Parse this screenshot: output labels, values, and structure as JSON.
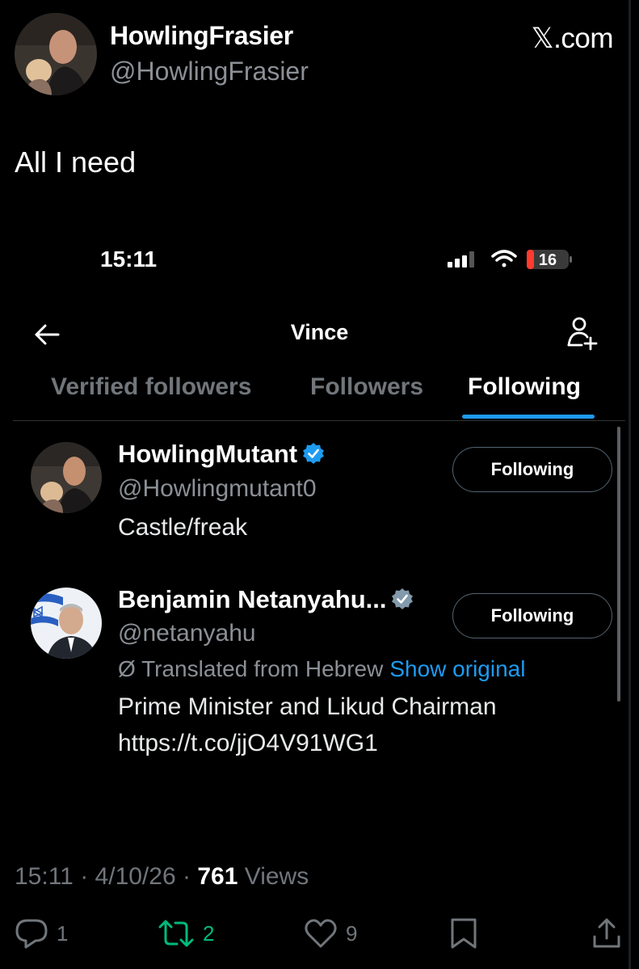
{
  "tweet": {
    "author_name": "HowlingFrasier",
    "author_handle": "@HowlingFrasier",
    "site": "𝕏.com",
    "text": "All I need",
    "time": "15:11",
    "date": "4/10/26",
    "separator": "·",
    "views_count": "761",
    "views_label": "Views",
    "replies": "1",
    "retweets": "2",
    "likes": "9"
  },
  "screenshot": {
    "status_time": "15:11",
    "battery": "16",
    "nav_title": "Vince",
    "tabs": [
      {
        "label": "Verified followers",
        "active": false
      },
      {
        "label": "Followers",
        "active": false
      },
      {
        "label": "Following",
        "active": true
      }
    ],
    "users": [
      {
        "name": "HowlingMutant",
        "handle": "@Howlingmutant0",
        "bio": "Castle/freak",
        "button": "Following"
      },
      {
        "name": "Benjamin Netanyahu...",
        "handle": "@netanyahu",
        "translated_label": "Translated from Hebrew",
        "show_original": "Show original",
        "bio_line1": "Prime Minister and Likud Chairman",
        "bio_line2": "https://t.co/jjO4V91WG1",
        "button": "Following"
      }
    ]
  },
  "colors": {
    "accent": "#1d9bf0",
    "retweet": "#00ba7c",
    "muted": "#71767b",
    "background": "#000000"
  },
  "icons": [
    "back-arrow-icon",
    "add-user-icon",
    "verified-badge-icon",
    "reply-icon",
    "retweet-icon",
    "like-icon",
    "bookmark-icon",
    "share-icon",
    "signal-icon",
    "wifi-icon",
    "battery-icon"
  ]
}
